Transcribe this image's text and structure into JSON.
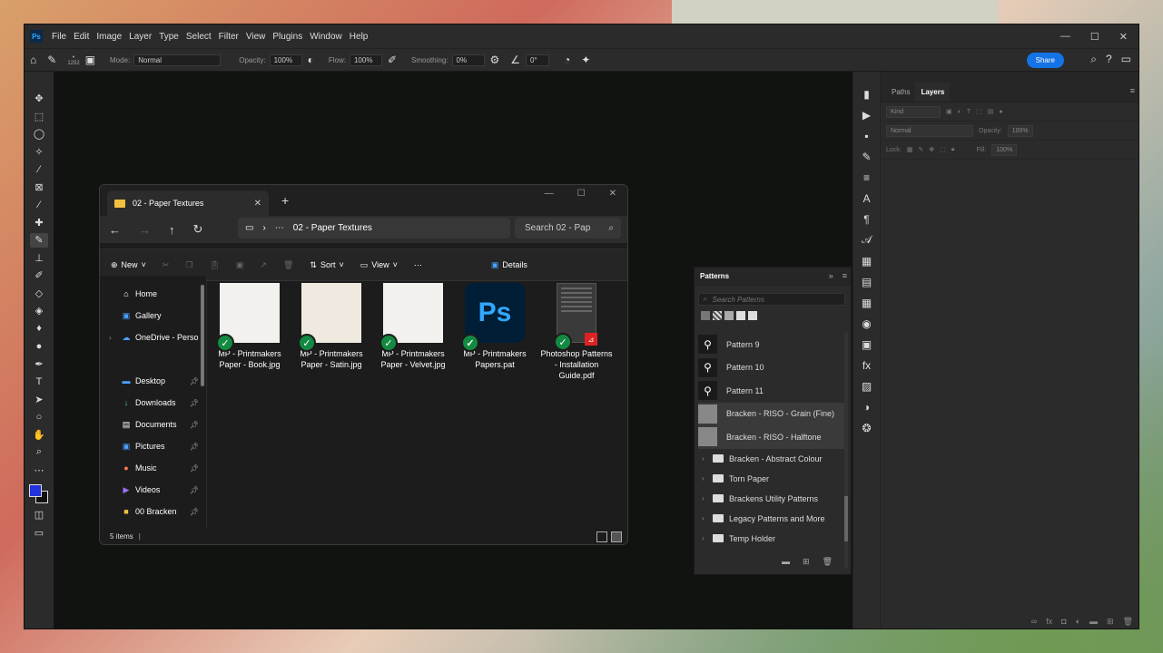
{
  "photoshop": {
    "logo": "Ps",
    "menu": [
      "File",
      "Edit",
      "Image",
      "Layer",
      "Type",
      "Select",
      "Filter",
      "View",
      "Plugins",
      "Window",
      "Help"
    ],
    "options": {
      "brush_size": "1252",
      "mode_label": "Mode:",
      "mode_value": "Normal",
      "opacity_label": "Opacity:",
      "opacity_value": "100%",
      "flow_label": "Flow:",
      "flow_value": "100%",
      "smoothing_label": "Smoothing:",
      "smoothing_value": "0%",
      "angle_value": "0°",
      "share_label": "Share"
    },
    "layers_panel": {
      "tabs": [
        "Paths",
        "Layers"
      ],
      "active_tab": "Layers",
      "filter_kind": "Kind",
      "blend_mode": "Normal",
      "opacity_label": "Opacity:",
      "opacity_value": "100%",
      "lock_label": "Lock:",
      "fill_label": "Fill:",
      "fill_value": "100%"
    },
    "patterns_panel": {
      "title": "Patterns",
      "search_placeholder": "Search Patterns",
      "items": [
        {
          "label": "Pattern 9",
          "thumb": "bw"
        },
        {
          "label": "Pattern 10",
          "thumb": "bw"
        },
        {
          "label": "Pattern 11",
          "thumb": "bw"
        },
        {
          "label": "Bracken - RISO - Grain (Fine)",
          "thumb": "grey"
        },
        {
          "label": "Bracken - RISO - Halftone",
          "thumb": "grey"
        }
      ],
      "groups": [
        "Bracken - Abstract Colour",
        "Torn Paper",
        "Brackens Utility Patterns",
        "Legacy Patterns and More",
        "Temp Holder"
      ]
    }
  },
  "explorer": {
    "tab_title": "02 - Paper Textures",
    "address": "02 - Paper Textures",
    "search": "Search 02 - Pap",
    "commands": {
      "new": "New",
      "sort": "Sort",
      "view": "View",
      "details": "Details"
    },
    "nav": {
      "home": "Home",
      "gallery": "Gallery",
      "onedrive": "OneDrive - Perso",
      "desktop": "Desktop",
      "downloads": "Downloads",
      "documents": "Documents",
      "pictures": "Pictures",
      "music": "Music",
      "videos": "Videos",
      "bracken": "00 Bracken"
    },
    "files": [
      {
        "name": "MP - Printmakers Paper - Book.jpg",
        "kind": "image"
      },
      {
        "name": "MP - Printmakers Paper - Satin.jpg",
        "kind": "image"
      },
      {
        "name": "MP - Printmakers Paper - Velvet.jpg",
        "kind": "image"
      },
      {
        "name": "MP - Printmakers Papers.pat",
        "kind": "ps",
        "icon_text": "Ps"
      },
      {
        "name": "Photoshop Patterns - Installation Guide.pdf",
        "kind": "pdf"
      }
    ],
    "status": "5 items"
  },
  "colors": {
    "accent_blue": "#1473e6",
    "foreground_color": "#2233dd",
    "check_green": "#138a41",
    "folder_yellow": "#f4c040"
  }
}
